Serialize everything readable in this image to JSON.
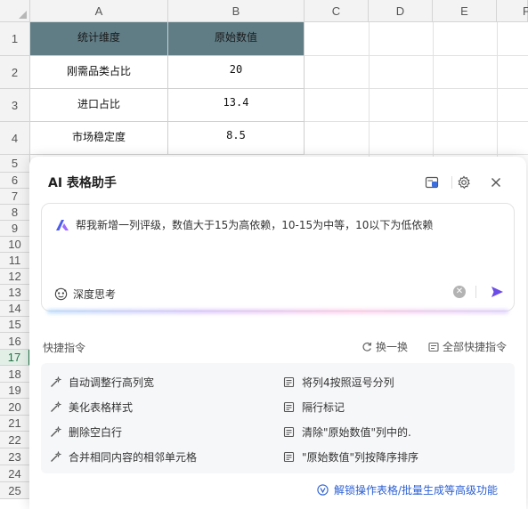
{
  "sheet": {
    "columns": [
      "A",
      "B",
      "C",
      "D",
      "E",
      "F"
    ],
    "rows": [
      "1",
      "2",
      "3",
      "4",
      "5",
      "6",
      "7",
      "8",
      "9",
      "10",
      "11",
      "12",
      "13",
      "14",
      "15",
      "16",
      "17",
      "18",
      "19",
      "20",
      "21",
      "22",
      "23",
      "24",
      "25"
    ],
    "active_row": "17",
    "table": {
      "headers": [
        "统计维度",
        "原始数值"
      ],
      "rows": [
        [
          "刚需品类占比",
          "20"
        ],
        [
          "进口占比",
          "13.4"
        ],
        [
          "市场稳定度",
          "8.5"
        ]
      ]
    },
    "colors": {
      "header_fill": "#607d86",
      "active_row": "#217346"
    }
  },
  "assistant": {
    "title": "AI 表格助手",
    "prompt_text": "帮我新增一列评级，数值大于15为高依赖，10-15为中等，10以下为低依赖",
    "deep_think_label": "深度思考",
    "quick_label": "快捷指令",
    "refresh_label": "换一换",
    "all_commands_label": "全部快捷指令",
    "commands": [
      "自动调整行高列宽",
      "美化表格样式",
      "删除空白行",
      "合并相同内容的相邻单元格",
      "将列4按照逗号分列",
      "隔行标记",
      "清除\"原始数值\"列中的.",
      "\"原始数值\"列按降序排序"
    ],
    "footer_link": "解锁操作表格/批量生成等高级功能",
    "icons": [
      "sidebar-toggle-icon",
      "gear-icon",
      "close-icon",
      "ai-logo-icon",
      "brain-icon",
      "clear-icon",
      "send-icon",
      "refresh-icon",
      "list-icon",
      "magic-wand-icon",
      "doc-icon",
      "vip-icon"
    ],
    "colors": {
      "accent": "#6b4ce6",
      "link": "#2a5fd3"
    }
  }
}
